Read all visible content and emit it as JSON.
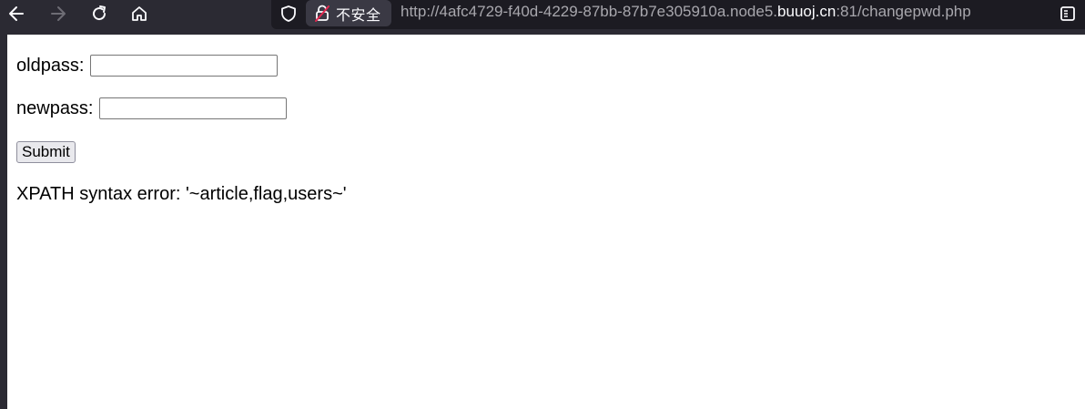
{
  "browser": {
    "back_icon": "arrow-left-icon",
    "forward_icon": "arrow-right-icon",
    "reload_icon": "reload-icon",
    "home_icon": "home-icon",
    "tracking_icon": "shield-icon",
    "security_label": "不安全",
    "url": {
      "prefix": "http://4afc4729-f40d-4229-87bb-87b7e305910a.node5.",
      "host": "buuoj.cn",
      "suffix": ":81/changepwd.php"
    },
    "reader_icon": "reader-view-icon"
  },
  "form": {
    "oldpass_label": "oldpass:",
    "oldpass_value": "",
    "newpass_label": "newpass:",
    "newpass_value": "",
    "submit_label": "Submit"
  },
  "message": "XPATH syntax error: '~article,flag,users~'",
  "colors": {
    "toolbar_bg": "#2b2a33",
    "urlbar_bg": "#1c1b22",
    "insecure_red": "#e22850",
    "page_bg": "#ffffff"
  }
}
